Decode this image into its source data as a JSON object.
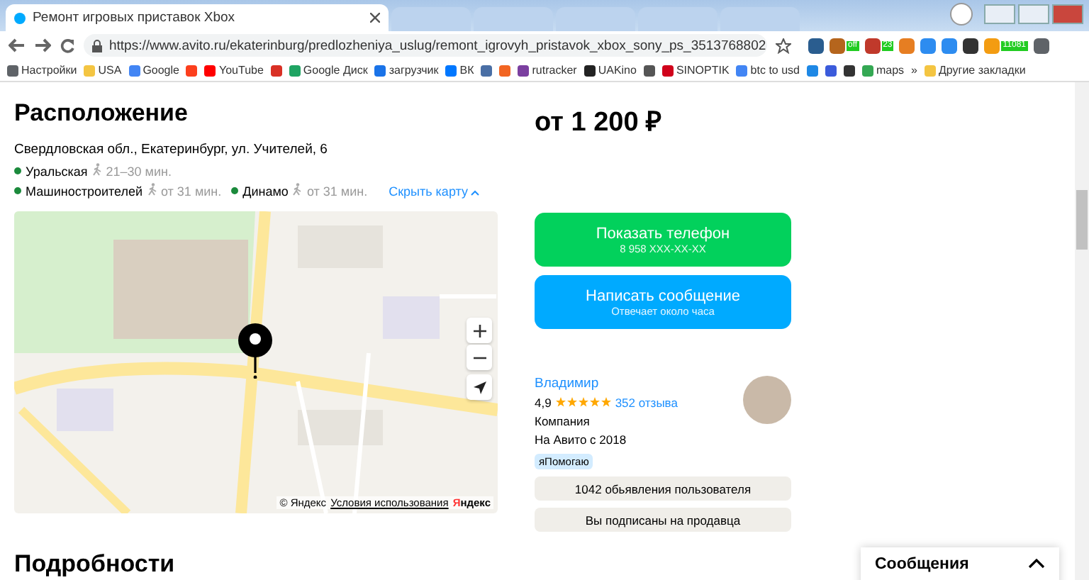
{
  "browser": {
    "tab": {
      "title": "Ремонт игровых приставок Xbox",
      "selected": true
    },
    "address": "https://www.avito.ru/ekaterinburg/predlozheniya_uslug/remont_igrovyh_pristavok_xbox_sony_ps_3513768802",
    "extensions": [
      {
        "color": "#2a5d8f"
      },
      {
        "color": "#b5651d",
        "badge": "off"
      },
      {
        "color": "#c0392b",
        "badge": "23"
      },
      {
        "color": "#e67e22"
      },
      {
        "color": "#2d8cf0"
      },
      {
        "color": "#2d8cf0"
      },
      {
        "color": "#333333"
      },
      {
        "color": "#f39c12",
        "badge": "11081"
      },
      {
        "color": "#5f6368"
      }
    ],
    "bookmarks": [
      {
        "label": "Настройки",
        "color": "#5f6368"
      },
      {
        "label": "USA",
        "color": "#f4c542"
      },
      {
        "label": "Google",
        "color": "#4285f4"
      },
      {
        "color": "#fc3f1d"
      },
      {
        "label": "YouTube",
        "color": "#ff0000"
      },
      {
        "color": "#d93025"
      },
      {
        "label": "Google Диск",
        "color": "#1fa463"
      },
      {
        "label": "загрузчик",
        "color": "#1a73e8"
      },
      {
        "label": "ВК",
        "color": "#0077ff"
      },
      {
        "color": "#4a6fa5"
      },
      {
        "color": "#f26522"
      },
      {
        "label": "rutracker",
        "color": "#7b3fa0"
      },
      {
        "label": "UAKino",
        "color": "#222222"
      },
      {
        "color": "#555555"
      },
      {
        "label": "SINOPTIK",
        "color": "#d0021b"
      },
      {
        "label": "btc to usd",
        "color": "#4285f4"
      },
      {
        "color": "#1e88e5"
      },
      {
        "color": "#3b5bdb"
      },
      {
        "color": "#333333"
      },
      {
        "label": "maps",
        "color": "#34a853"
      }
    ],
    "more": "»",
    "other_bookmarks": "Другие закладки"
  },
  "location": {
    "title": "Расположение",
    "address": "Свердловская обл., Екатеринбург, ул. Учителей, 6",
    "metro": [
      [
        {
          "station": "Уральская",
          "time": "21–30 мин."
        }
      ],
      [
        {
          "station": "Машиностроителей",
          "time": "от 31 мин."
        },
        {
          "station": "Динамо",
          "time": "от 31 мин."
        }
      ]
    ],
    "hide_map": "Скрыть карту",
    "map": {
      "copyright": "© Яндекс",
      "terms": "Условия использования",
      "logo_first": "Я",
      "logo_rest": "ндекс"
    }
  },
  "details_title": "Подробности",
  "offer": {
    "price": "от 1 200 ₽",
    "call_button": {
      "label": "Показать телефон",
      "sub": "8 958 XXX-XX-XX"
    },
    "message_button": {
      "label": "Написать сообщение",
      "sub": "Отвечает около часа"
    }
  },
  "seller": {
    "name": "Владимир",
    "rating": "4,9",
    "stars": 5,
    "reviews": "352 отзыва",
    "type": "Компания",
    "since": "На Авито с 2018",
    "badge": "яПомогаю",
    "buttons": [
      "1042 обьявления пользователя",
      "Вы подписаны на продавца"
    ]
  },
  "messages": {
    "title": "Сообщения",
    "expanded": false
  }
}
